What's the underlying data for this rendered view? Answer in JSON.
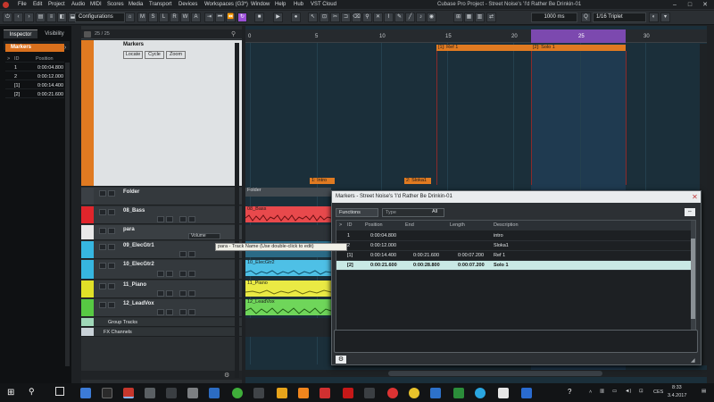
{
  "menubar": {
    "items": [
      "File",
      "Edit",
      "Project",
      "Audio",
      "MIDI",
      "Scores",
      "Media",
      "Transport",
      "Devices",
      "Workspaces (G3*)",
      "Window",
      "Help",
      "Hub",
      "VST Cloud"
    ],
    "window_title": "Cubase Pro Project - Street Noise's 'I'd Rather Be Drinkin-01"
  },
  "toolbar": {
    "configurations": "Configurations",
    "msrwa": [
      "M",
      "S",
      "L",
      "R",
      "W",
      "A"
    ],
    "tempo": "1000 ms",
    "quantize": "1/16 Triplet"
  },
  "inspector": {
    "tab_inspector": "Inspector",
    "tab_visibility": "Visibility",
    "section": "Markers",
    "col_id": "ID",
    "col_pos": "Position",
    "rows": [
      {
        "id": "1",
        "pos": "0:00:04.800"
      },
      {
        "id": "2",
        "pos": "0:00:12.000"
      },
      {
        "id": "[1]",
        "pos": "0:00:14.400"
      },
      {
        "id": "[2]",
        "pos": "0:00:21.600"
      }
    ]
  },
  "tracklist": {
    "count": "25 / 25",
    "marker_track": {
      "name": "Markers",
      "locate": "Locate",
      "cycle": "Cycle",
      "zoom": "Zoom"
    },
    "tracks": [
      {
        "name": "Folder",
        "color": "#3b4045"
      },
      {
        "name": "08_Bass",
        "color": "#e0252b"
      },
      {
        "name": "para",
        "color": "#e8e8e8",
        "volume": "Volume"
      },
      {
        "name": "09_ElecGtr1",
        "color": "#36b6e0"
      },
      {
        "name": "10_ElecGtr2",
        "color": "#36b6e0"
      },
      {
        "name": "11_Piano",
        "color": "#e0e028"
      },
      {
        "name": "12_LeadVox",
        "color": "#57c943"
      }
    ],
    "group_tracks": "Group Tracks",
    "fx_channels": "FX Channels",
    "tooltip": "para - Track Name (Use double-click to edit)"
  },
  "project": {
    "ruler_ticks": [
      "0",
      "5",
      "10",
      "15",
      "20",
      "25",
      "30"
    ],
    "markers": [
      {
        "label": "1: Intro"
      },
      {
        "label": "2: Sloka1"
      },
      {
        "label": "[1]: Ref 1"
      },
      {
        "label": "[2]: Solo 1"
      }
    ],
    "events": {
      "folder": "Folder",
      "bass": "08_Bass",
      "gtr2": "10_ElecGtr2",
      "piano": "11_Piano",
      "vox": "12_LeadVox"
    }
  },
  "markers_window": {
    "title": "Markers - Street Noise's 'I'd Rather Be Drinkin-01",
    "functions": "Functions",
    "type": "Type",
    "all": "All",
    "cols": [
      "ID",
      "Position",
      "End",
      "Length",
      "Description"
    ],
    "rows": [
      {
        "id": "1",
        "pos": "0:00:04.800",
        "end": "",
        "len": "",
        "desc": "intro"
      },
      {
        "id": "2",
        "pos": "0:00:12.000",
        "end": "",
        "len": "",
        "desc": "Sloka1"
      },
      {
        "id": "[1]",
        "pos": "0:00:14.400",
        "end": "0:00:21.600",
        "len": "0:00:07.200",
        "desc": "Ref 1"
      },
      {
        "id": "[2]",
        "pos": "0:00:21.600",
        "end": "0:00:28.800",
        "len": "0:00:07.200",
        "desc": "Solo 1"
      }
    ]
  },
  "taskbar": {
    "clock_time": "8:33",
    "clock_date": "3.4.2017",
    "lang": "CES"
  },
  "colors": {
    "accent": "#9b4fd6",
    "marker": "#e07a21",
    "selected_row": "#c9e9e5"
  }
}
